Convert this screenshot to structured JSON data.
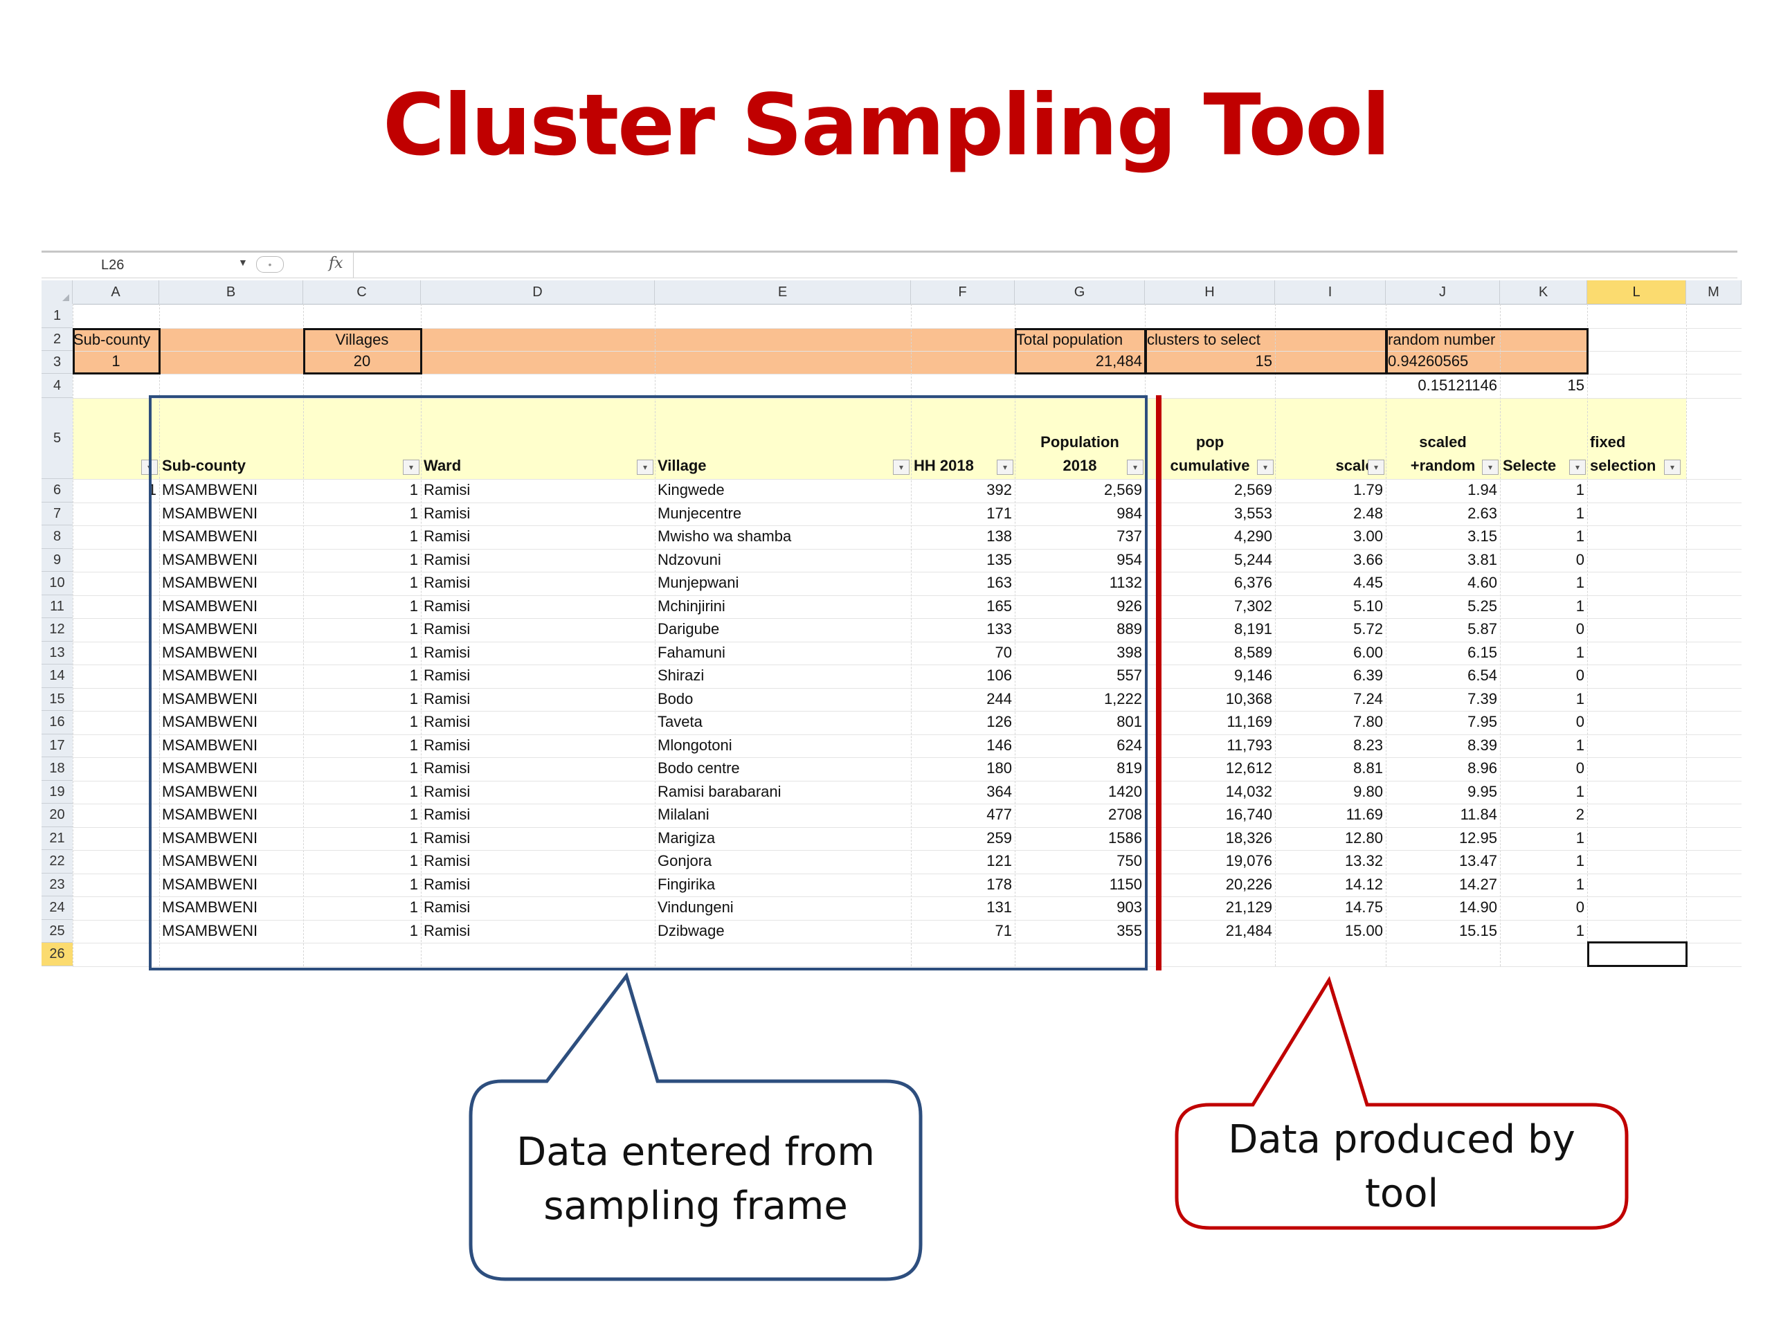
{
  "title": "Cluster Sampling Tool",
  "formula_bar": {
    "name_box": "L26",
    "fx": "fx"
  },
  "columns": [
    "A",
    "B",
    "C",
    "D",
    "E",
    "F",
    "G",
    "H",
    "I",
    "J",
    "K",
    "L",
    "M"
  ],
  "row_numbers": [
    "1",
    "2",
    "3",
    "4",
    "5",
    "6",
    "7",
    "8",
    "9",
    "10",
    "11",
    "12",
    "13",
    "14",
    "15",
    "16",
    "17",
    "18",
    "19",
    "20",
    "21",
    "22",
    "23",
    "24",
    "25",
    "26"
  ],
  "summary": {
    "subcounty_label": "Sub-county",
    "subcounty_value": "1",
    "villages_label": "Villages",
    "villages_value": "20",
    "total_pop_label": "Total population",
    "total_pop_value": "21,484",
    "clusters_label": "clusters to select",
    "clusters_value": "15",
    "random_label": "random number",
    "random_value": "0.94260565",
    "row4_value": "0.15121146",
    "row4_k": "15"
  },
  "headers": {
    "subcounty": "Sub-county",
    "ward": "Ward",
    "village": "Village",
    "hh": "HH 2018",
    "population_l1": "Population",
    "population_l2": "2018",
    "pop_l1": "pop",
    "pop_l2": "cumulative",
    "scaled": "scaled",
    "scaled_random_l1": "scaled",
    "scaled_random_l2": "+random",
    "selected": "Selecte",
    "fixed_l1": "fixed",
    "fixed_l2": "selection"
  },
  "rows": [
    {
      "a": "1",
      "sub": "MSAMBWENI",
      "c": "1",
      "ward": "Ramisi",
      "village": "Kingwede",
      "hh": "392",
      "pop": "2,569",
      "cum": "2,569",
      "scaled": "1.79",
      "sr": "1.94",
      "sel": "1"
    },
    {
      "a": "",
      "sub": "MSAMBWENI",
      "c": "1",
      "ward": "Ramisi",
      "village": "Munjecentre",
      "hh": "171",
      "pop": "984",
      "cum": "3,553",
      "scaled": "2.48",
      "sr": "2.63",
      "sel": "1"
    },
    {
      "a": "",
      "sub": "MSAMBWENI",
      "c": "1",
      "ward": "Ramisi",
      "village": "Mwisho wa shamba",
      "hh": "138",
      "pop": "737",
      "cum": "4,290",
      "scaled": "3.00",
      "sr": "3.15",
      "sel": "1"
    },
    {
      "a": "",
      "sub": "MSAMBWENI",
      "c": "1",
      "ward": "Ramisi",
      "village": "Ndzovuni",
      "hh": "135",
      "pop": "954",
      "cum": "5,244",
      "scaled": "3.66",
      "sr": "3.81",
      "sel": "0"
    },
    {
      "a": "",
      "sub": "MSAMBWENI",
      "c": "1",
      "ward": "Ramisi",
      "village": "Munjepwani",
      "hh": "163",
      "pop": "1132",
      "cum": "6,376",
      "scaled": "4.45",
      "sr": "4.60",
      "sel": "1"
    },
    {
      "a": "",
      "sub": "MSAMBWENI",
      "c": "1",
      "ward": "Ramisi",
      "village": "Mchinjirini",
      "hh": "165",
      "pop": "926",
      "cum": "7,302",
      "scaled": "5.10",
      "sr": "5.25",
      "sel": "1"
    },
    {
      "a": "",
      "sub": "MSAMBWENI",
      "c": "1",
      "ward": "Ramisi",
      "village": "Darigube",
      "hh": "133",
      "pop": "889",
      "cum": "8,191",
      "scaled": "5.72",
      "sr": "5.87",
      "sel": "0"
    },
    {
      "a": "",
      "sub": "MSAMBWENI",
      "c": "1",
      "ward": "Ramisi",
      "village": "Fahamuni",
      "hh": "70",
      "pop": "398",
      "cum": "8,589",
      "scaled": "6.00",
      "sr": "6.15",
      "sel": "1"
    },
    {
      "a": "",
      "sub": "MSAMBWENI",
      "c": "1",
      "ward": "Ramisi",
      "village": "Shirazi",
      "hh": "106",
      "pop": "557",
      "cum": "9,146",
      "scaled": "6.39",
      "sr": "6.54",
      "sel": "0"
    },
    {
      "a": "",
      "sub": "MSAMBWENI",
      "c": "1",
      "ward": "Ramisi",
      "village": "Bodo",
      "hh": "244",
      "pop": "1,222",
      "cum": "10,368",
      "scaled": "7.24",
      "sr": "7.39",
      "sel": "1"
    },
    {
      "a": "",
      "sub": "MSAMBWENI",
      "c": "1",
      "ward": "Ramisi",
      "village": "Taveta",
      "hh": "126",
      "pop": "801",
      "cum": "11,169",
      "scaled": "7.80",
      "sr": "7.95",
      "sel": "0"
    },
    {
      "a": "",
      "sub": "MSAMBWENI",
      "c": "1",
      "ward": "Ramisi",
      "village": "Mlongotoni",
      "hh": "146",
      "pop": "624",
      "cum": "11,793",
      "scaled": "8.23",
      "sr": "8.39",
      "sel": "1"
    },
    {
      "a": "",
      "sub": "MSAMBWENI",
      "c": "1",
      "ward": "Ramisi",
      "village": "Bodo centre",
      "hh": "180",
      "pop": "819",
      "cum": "12,612",
      "scaled": "8.81",
      "sr": "8.96",
      "sel": "0"
    },
    {
      "a": "",
      "sub": "MSAMBWENI",
      "c": "1",
      "ward": "Ramisi",
      "village": "Ramisi barabarani",
      "hh": "364",
      "pop": "1420",
      "cum": "14,032",
      "scaled": "9.80",
      "sr": "9.95",
      "sel": "1"
    },
    {
      "a": "",
      "sub": "MSAMBWENI",
      "c": "1",
      "ward": "Ramisi",
      "village": "Milalani",
      "hh": "477",
      "pop": "2708",
      "cum": "16,740",
      "scaled": "11.69",
      "sr": "11.84",
      "sel": "2"
    },
    {
      "a": "",
      "sub": "MSAMBWENI",
      "c": "1",
      "ward": "Ramisi",
      "village": "Marigiza",
      "hh": "259",
      "pop": "1586",
      "cum": "18,326",
      "scaled": "12.80",
      "sr": "12.95",
      "sel": "1"
    },
    {
      "a": "",
      "sub": "MSAMBWENI",
      "c": "1",
      "ward": "Ramisi",
      "village": "Gonjora",
      "hh": "121",
      "pop": "750",
      "cum": "19,076",
      "scaled": "13.32",
      "sr": "13.47",
      "sel": "1"
    },
    {
      "a": "",
      "sub": "MSAMBWENI",
      "c": "1",
      "ward": "Ramisi",
      "village": "Fingirika",
      "hh": "178",
      "pop": "1150",
      "cum": "20,226",
      "scaled": "14.12",
      "sr": "14.27",
      "sel": "1"
    },
    {
      "a": "",
      "sub": "MSAMBWENI",
      "c": "1",
      "ward": "Ramisi",
      "village": "Vindungeni",
      "hh": "131",
      "pop": "903",
      "cum": "21,129",
      "scaled": "14.75",
      "sr": "14.90",
      "sel": "0"
    },
    {
      "a": "",
      "sub": "MSAMBWENI",
      "c": "1",
      "ward": "Ramisi",
      "village": "Dzibwage",
      "hh": "71",
      "pop": "355",
      "cum": "21,484",
      "scaled": "15.00",
      "sr": "15.15",
      "sel": "1"
    }
  ],
  "callouts": {
    "left_line1": "Data entered from",
    "left_line2": "sampling frame",
    "right_line1": "Data produced by",
    "right_line2": "tool"
  },
  "colors": {
    "title": "#c00000",
    "orange_band": "#fac090",
    "header_fill": "#ffffcc",
    "blue": "#2d4e7e",
    "red": "#c00000"
  }
}
